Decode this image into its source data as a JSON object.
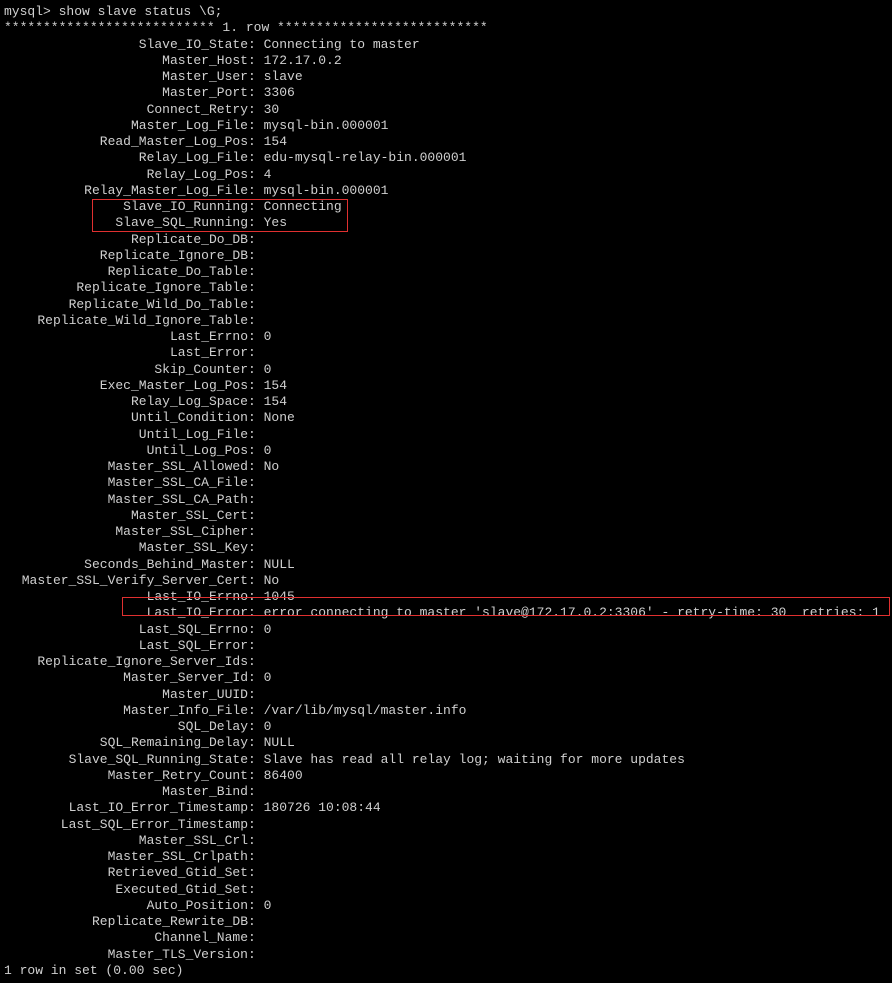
{
  "prompt": "mysql> show slave status \\G;",
  "row_sep": "*************************** 1. row ***************************",
  "trailer": "1 row in set (0.00 sec)",
  "fields": [
    {
      "k": "Slave_IO_State",
      "v": "Connecting to master"
    },
    {
      "k": "Master_Host",
      "v": "172.17.0.2"
    },
    {
      "k": "Master_User",
      "v": "slave"
    },
    {
      "k": "Master_Port",
      "v": "3306"
    },
    {
      "k": "Connect_Retry",
      "v": "30"
    },
    {
      "k": "Master_Log_File",
      "v": "mysql-bin.000001"
    },
    {
      "k": "Read_Master_Log_Pos",
      "v": "154"
    },
    {
      "k": "Relay_Log_File",
      "v": "edu-mysql-relay-bin.000001"
    },
    {
      "k": "Relay_Log_Pos",
      "v": "4"
    },
    {
      "k": "Relay_Master_Log_File",
      "v": "mysql-bin.000001"
    },
    {
      "k": "Slave_IO_Running",
      "v": "Connecting"
    },
    {
      "k": "Slave_SQL_Running",
      "v": "Yes"
    },
    {
      "k": "Replicate_Do_DB",
      "v": ""
    },
    {
      "k": "Replicate_Ignore_DB",
      "v": ""
    },
    {
      "k": "Replicate_Do_Table",
      "v": ""
    },
    {
      "k": "Replicate_Ignore_Table",
      "v": ""
    },
    {
      "k": "Replicate_Wild_Do_Table",
      "v": ""
    },
    {
      "k": "Replicate_Wild_Ignore_Table",
      "v": ""
    },
    {
      "k": "Last_Errno",
      "v": "0"
    },
    {
      "k": "Last_Error",
      "v": ""
    },
    {
      "k": "Skip_Counter",
      "v": "0"
    },
    {
      "k": "Exec_Master_Log_Pos",
      "v": "154"
    },
    {
      "k": "Relay_Log_Space",
      "v": "154"
    },
    {
      "k": "Until_Condition",
      "v": "None"
    },
    {
      "k": "Until_Log_File",
      "v": ""
    },
    {
      "k": "Until_Log_Pos",
      "v": "0"
    },
    {
      "k": "Master_SSL_Allowed",
      "v": "No"
    },
    {
      "k": "Master_SSL_CA_File",
      "v": ""
    },
    {
      "k": "Master_SSL_CA_Path",
      "v": ""
    },
    {
      "k": "Master_SSL_Cert",
      "v": ""
    },
    {
      "k": "Master_SSL_Cipher",
      "v": ""
    },
    {
      "k": "Master_SSL_Key",
      "v": ""
    },
    {
      "k": "Seconds_Behind_Master",
      "v": "NULL"
    },
    {
      "k": "Master_SSL_Verify_Server_Cert",
      "v": "No"
    },
    {
      "k": "Last_IO_Errno",
      "v": "1045"
    },
    {
      "k": "Last_IO_Error",
      "v": "error connecting to master 'slave@172.17.0.2:3306' - retry-time: 30  retries: 1"
    },
    {
      "k": "Last_SQL_Errno",
      "v": "0"
    },
    {
      "k": "Last_SQL_Error",
      "v": ""
    },
    {
      "k": "Replicate_Ignore_Server_Ids",
      "v": ""
    },
    {
      "k": "Master_Server_Id",
      "v": "0"
    },
    {
      "k": "Master_UUID",
      "v": ""
    },
    {
      "k": "Master_Info_File",
      "v": "/var/lib/mysql/master.info"
    },
    {
      "k": "SQL_Delay",
      "v": "0"
    },
    {
      "k": "SQL_Remaining_Delay",
      "v": "NULL"
    },
    {
      "k": "Slave_SQL_Running_State",
      "v": "Slave has read all relay log; waiting for more updates"
    },
    {
      "k": "Master_Retry_Count",
      "v": "86400"
    },
    {
      "k": "Master_Bind",
      "v": ""
    },
    {
      "k": "Last_IO_Error_Timestamp",
      "v": "180726 10:08:44"
    },
    {
      "k": "Last_SQL_Error_Timestamp",
      "v": ""
    },
    {
      "k": "Master_SSL_Crl",
      "v": ""
    },
    {
      "k": "Master_SSL_Crlpath",
      "v": ""
    },
    {
      "k": "Retrieved_Gtid_Set",
      "v": ""
    },
    {
      "k": "Executed_Gtid_Set",
      "v": ""
    },
    {
      "k": "Auto_Position",
      "v": "0"
    },
    {
      "k": "Replicate_Rewrite_DB",
      "v": ""
    },
    {
      "k": "Channel_Name",
      "v": ""
    },
    {
      "k": "Master_TLS_Version",
      "v": ""
    }
  ]
}
